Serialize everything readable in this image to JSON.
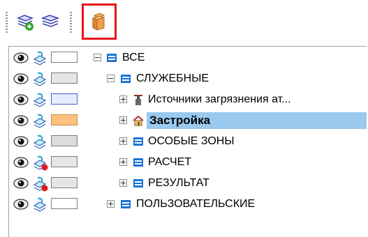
{
  "toolbar": {
    "buttons": [
      {
        "name": "add-layer-icon"
      },
      {
        "name": "layers-icon"
      },
      {
        "name": "map-objects-icon"
      }
    ]
  },
  "tree": {
    "rows": [
      {
        "label": "ВСЕ",
        "bold": false,
        "expander": "minus",
        "icon": "folder-icon",
        "swatch": "#ffffff",
        "marker": "none"
      },
      {
        "label": "СЛУЖЕБНЫЕ",
        "bold": false,
        "expander": "minus",
        "icon": "folder-icon",
        "swatch": "#e6e6e6",
        "marker": "none"
      },
      {
        "label": "Источники загрязнения ат...",
        "bold": false,
        "expander": "plus",
        "icon": "factory-icon",
        "swatch": "#e8ecff",
        "marker": "none"
      },
      {
        "label": "Застройка",
        "bold": true,
        "expander": "plus",
        "icon": "house-icon",
        "swatch": "#ffc080",
        "marker": "none"
      },
      {
        "label": "ОСОБЫЕ ЗОНЫ",
        "bold": false,
        "expander": "plus",
        "icon": "folder-icon",
        "swatch": "#dcdcdc",
        "marker": "none"
      },
      {
        "label": "РАСЧЕТ",
        "bold": false,
        "expander": "plus",
        "icon": "folder-icon",
        "swatch": "#e6e6e6",
        "marker": "red"
      },
      {
        "label": "РЕЗУЛЬТАТ",
        "bold": false,
        "expander": "plus",
        "icon": "folder-icon",
        "swatch": "#e6e6e6",
        "marker": "red"
      },
      {
        "label": "ПОЛЬЗОВАТЕЛЬСКИЕ",
        "bold": false,
        "expander": "plus",
        "icon": "folder-icon",
        "swatch": "#ffffff",
        "marker": "none"
      }
    ]
  },
  "colors": {
    "highlight_border": "#e8151b",
    "selection": "#99c9ef",
    "folder_blue": "#1a73d9"
  }
}
